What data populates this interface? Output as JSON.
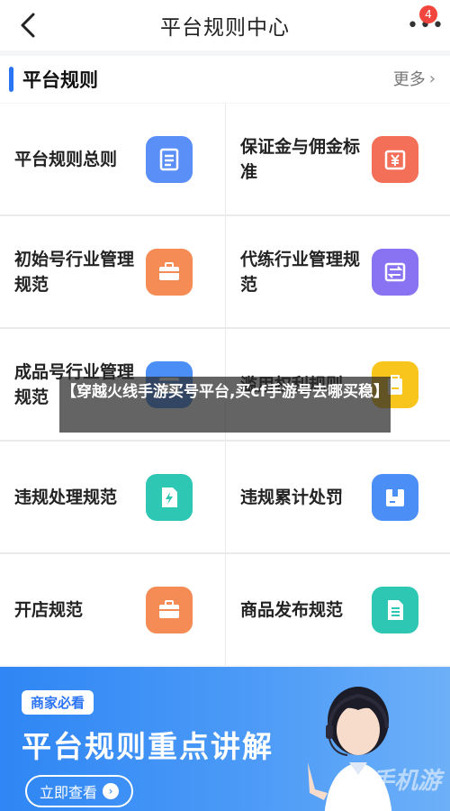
{
  "nav": {
    "title": "平台规则中心",
    "badge": "4"
  },
  "section": {
    "title": "平台规则",
    "more": "更多"
  },
  "items": [
    {
      "label": "平台规则总则",
      "icon": "document-icon",
      "color": "#5b8ff8"
    },
    {
      "label": "保证金与佣金标准",
      "icon": "yen-icon",
      "color": "#f36f58"
    },
    {
      "label": "初始号行业管理规范",
      "icon": "briefcase-icon",
      "color": "#f58c55"
    },
    {
      "label": "代练行业管理规范",
      "icon": "exchange-icon",
      "color": "#8a73f2"
    },
    {
      "label": "成品号行业管理规范",
      "icon": "card-icon",
      "color": "#4b8ff6"
    },
    {
      "label": "滥用权利规则",
      "icon": "bag-icon",
      "color": "#f7c51c"
    },
    {
      "label": "违规处理规范",
      "icon": "lightning-doc-icon",
      "color": "#2ec7b4"
    },
    {
      "label": "违规累计处罚",
      "icon": "box-icon",
      "color": "#4b8ff6"
    },
    {
      "label": "开店规范",
      "icon": "shop-icon",
      "color": "#f58c55"
    },
    {
      "label": "商品发布规范",
      "icon": "list-doc-icon",
      "color": "#2ec7b4"
    }
  ],
  "banner": {
    "tag": "商家必看",
    "headline": "平台规则重点讲解",
    "cta": "立即查看",
    "watermark": "手机游"
  },
  "overlay": {
    "text": "【穿越火线手游买号平台,买cf手游号去哪买稳】"
  }
}
